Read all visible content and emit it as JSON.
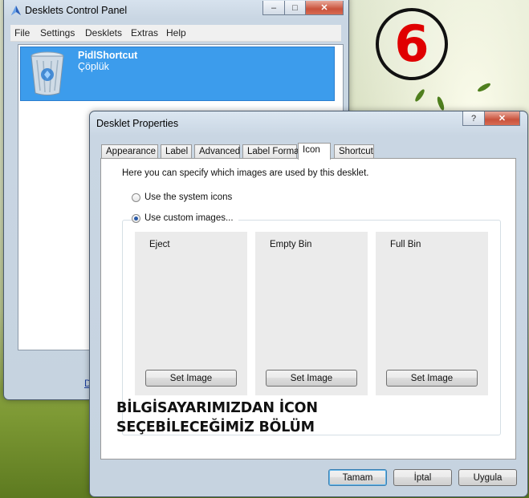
{
  "overlay": {
    "step_number": "6",
    "caption_line1": "BİLGİSAYARIMIZDAN İCON",
    "caption_line2": "SEÇEBİLECEĞİMİZ BÖLÜM"
  },
  "control_panel": {
    "title": "Desklets Control Panel",
    "menu": [
      "File",
      "Settings",
      "Desklets",
      "Extras",
      "Help"
    ],
    "list_items": [
      {
        "name": "PidlShortcut",
        "subtitle": "Çöplük",
        "icon": "recycle-bin-icon"
      }
    ],
    "partial_link": "D"
  },
  "dialog": {
    "title": "Desklet Properties",
    "tabs": [
      "Appearance",
      "Label",
      "Advanced",
      "Label Format",
      "Icon",
      "Shortcut"
    ],
    "active_tab": "Icon",
    "description": "Here you can specify which images are used by this desklet.",
    "options": {
      "system_icons": "Use the system icons",
      "custom_images": "Use custom images..."
    },
    "selected_option": "custom_images",
    "image_slots": [
      {
        "label": "Eject",
        "button": "Set Image"
      },
      {
        "label": "Empty Bin",
        "button": "Set Image"
      },
      {
        "label": "Full Bin",
        "button": "Set Image"
      }
    ],
    "buttons": {
      "ok": "Tamam",
      "cancel": "İptal",
      "apply": "Uygula"
    }
  },
  "colors": {
    "selection": "#3c9cec",
    "badge_number": "#e00000"
  }
}
